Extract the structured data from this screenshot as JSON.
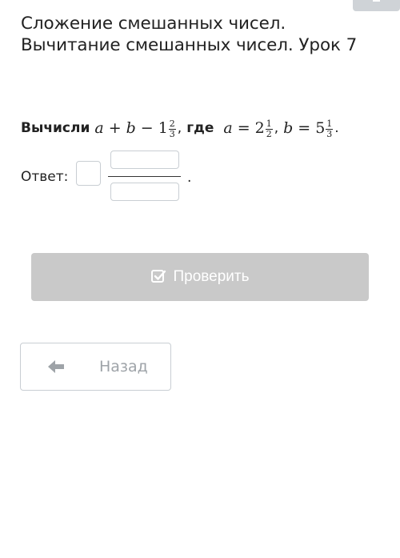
{
  "lesson": {
    "title": "Сложение смешанных чисел. Вычитание смешанных чисел. Урок 7"
  },
  "task": {
    "verb": "Вычисли",
    "where_word": "где",
    "var_a": "a",
    "var_b": "b",
    "plus": "+",
    "minus": "−",
    "equals": "=",
    "comma": ",",
    "period": ".",
    "subtrahend": {
      "whole": "1",
      "numerator": "2",
      "denominator": "3"
    },
    "a_value": {
      "whole": "2",
      "numerator": "1",
      "denominator": "2"
    },
    "b_value": {
      "whole": "5",
      "numerator": "1",
      "denominator": "3"
    }
  },
  "answer": {
    "label": "Ответ:",
    "whole_value": "",
    "numerator_value": "",
    "denominator_value": "",
    "trailing_dot": "."
  },
  "buttons": {
    "check_label": "Проверить",
    "check_icon": "checkbox-check-icon",
    "back_label": "Назад",
    "back_icon": "arrow-left-icon"
  },
  "colors": {
    "check_button_bg": "#c9c9c9",
    "input_border": "#c9ced3",
    "back_text": "#9ea3a8"
  }
}
